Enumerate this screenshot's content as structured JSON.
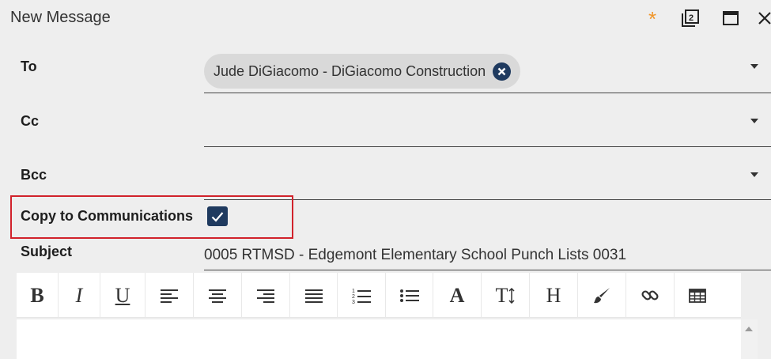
{
  "window": {
    "title": "New Message",
    "unsaved_indicator": "*",
    "accent_color": "#f0962a"
  },
  "fields": {
    "to": {
      "label": "To",
      "recipients": [
        {
          "name": "Jude DiGiacomo - DiGiacomo Construction"
        }
      ]
    },
    "cc": {
      "label": "Cc"
    },
    "bcc": {
      "label": "Bcc"
    },
    "copy_to_communications": {
      "label": "Copy to Communications",
      "checked": true
    },
    "subject": {
      "label": "Subject",
      "value": "0005 RTMSD - Edgemont Elementary School Punch Lists 0031"
    }
  },
  "toolbar": {
    "bold": "B",
    "italic": "I",
    "underline": "U",
    "font_color": "A",
    "font_size": "T",
    "heading": "H",
    "buttons": [
      "bold-icon",
      "italic-icon",
      "underline-icon",
      "align-left-icon",
      "align-center-icon",
      "align-right-icon",
      "justify-icon",
      "numbered-list-icon",
      "bulleted-list-icon",
      "font-color-icon",
      "font-size-icon",
      "heading-icon",
      "paint-brush-icon",
      "link-icon",
      "table-icon"
    ]
  },
  "colors": {
    "checkbox": "#1f3a5f",
    "highlight": "#d1222b",
    "chip": "#d9d9d9"
  }
}
